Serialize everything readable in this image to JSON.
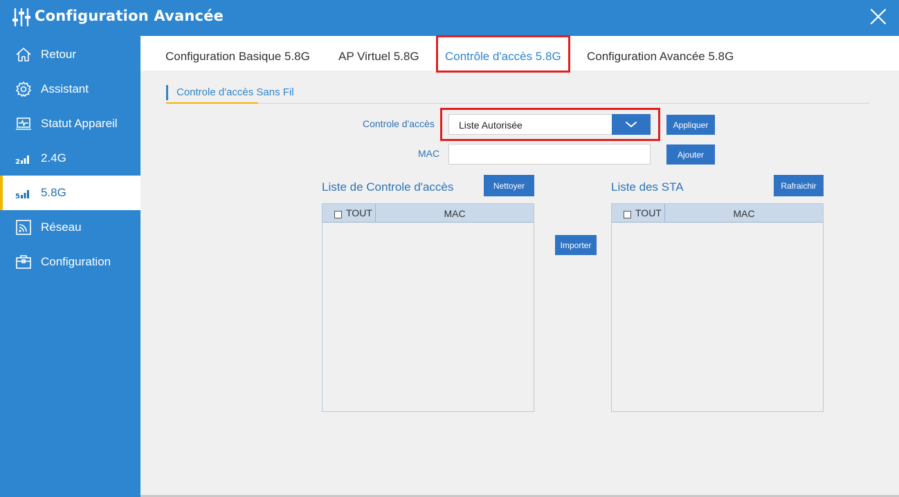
{
  "window": {
    "title": "Configuration Avancée"
  },
  "sidebar": {
    "items": [
      {
        "label": "Retour",
        "icon": "home-icon"
      },
      {
        "label": "Assistant",
        "icon": "gear-icon"
      },
      {
        "label": "Statut Appareil",
        "icon": "monitor-icon"
      },
      {
        "label": "2.4G",
        "icon": "signal-2g-icon"
      },
      {
        "label": "5.8G",
        "icon": "signal-5g-icon",
        "active": true
      },
      {
        "label": "Réseau",
        "icon": "network-icon"
      },
      {
        "label": "Configuration",
        "icon": "toolbox-icon"
      }
    ]
  },
  "tabs": [
    {
      "label": "Configuration Basique 5.8G"
    },
    {
      "label": "AP Virtuel 5.8G"
    },
    {
      "label": "Contrôle d'accès 5.8G",
      "active": true
    },
    {
      "label": "Configuration Avancée 5.8G"
    }
  ],
  "section": {
    "title": "Controle d'accès Sans Fil"
  },
  "form": {
    "access_control_label": "Controle d'accès",
    "access_control_value": "Liste Autorisée",
    "apply_label": "Appliquer",
    "mac_label": "MAC",
    "mac_value": "",
    "add_label": "Ajouter"
  },
  "acl_list": {
    "title": "Liste de Controle d'accès",
    "clear_label": "Nettoyer",
    "col_all": "TOUT",
    "col_mac": "MAC"
  },
  "import_label": "Importer",
  "sta_list": {
    "title": "Liste des STA",
    "refresh_label": "Rafraichir",
    "col_all": "TOUT",
    "col_mac": "MAC"
  },
  "colors": {
    "primary": "#2e86d0",
    "button": "#2e73c4",
    "highlight": "#e02020",
    "accent": "#f5b400"
  }
}
